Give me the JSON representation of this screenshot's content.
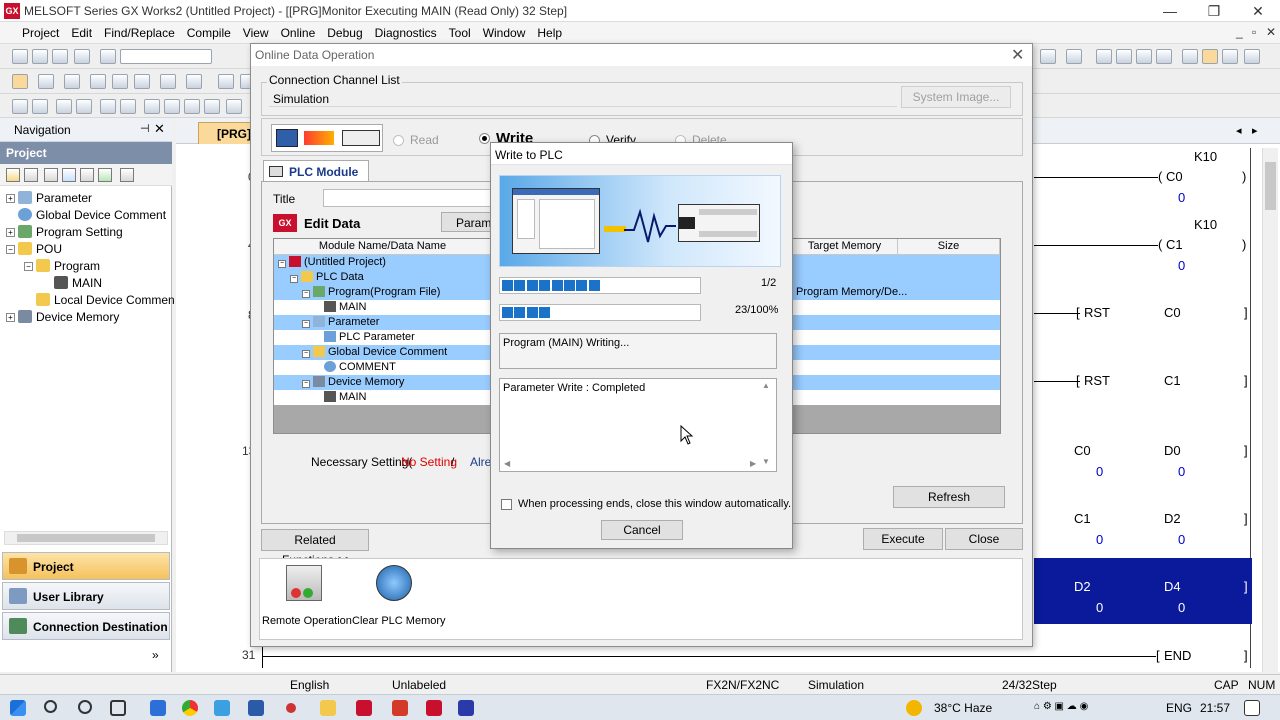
{
  "window": {
    "title": "MELSOFT Series GX Works2 (Untitled Project) - [[PRG]Monitor Executing MAIN (Read Only) 32 Step]",
    "app_icon": "GX",
    "controls": [
      "—",
      "❐",
      "✕"
    ]
  },
  "menubar": {
    "items": [
      "Project",
      "Edit",
      "Find/Replace",
      "Compile",
      "View",
      "Online",
      "Debug",
      "Diagnostics",
      "Tool",
      "Window",
      "Help"
    ],
    "mdi_controls": [
      "_",
      "▫",
      "✕"
    ]
  },
  "navigation": {
    "title": "Navigation",
    "pin": "⊣",
    "close": "✕",
    "section_title": "Project",
    "tree": [
      {
        "label": "Parameter",
        "level": 0,
        "expander": "+"
      },
      {
        "label": "Global Device Comment",
        "level": 0,
        "expander": ""
      },
      {
        "label": "Program Setting",
        "level": 0,
        "expander": "+"
      },
      {
        "label": "POU",
        "level": 0,
        "expander": "−"
      },
      {
        "label": "Program",
        "level": 1,
        "expander": "−"
      },
      {
        "label": "MAIN",
        "level": 2,
        "expander": ""
      },
      {
        "label": "Local Device Commen",
        "level": 1,
        "expander": ""
      },
      {
        "label": "Device Memory",
        "level": 0,
        "expander": "+"
      }
    ],
    "bottom_buttons": [
      "Project",
      "User Library",
      "Connection Destination"
    ],
    "more": "»"
  },
  "editor": {
    "tab_label": "[PRG]",
    "tab_nav": [
      "◂",
      "▸"
    ],
    "rung_numbers": [
      "0",
      "4",
      "8",
      "13",
      "31"
    ],
    "labels": {
      "k10_a": "K10",
      "c0_coil": "C0",
      "c0_val": "0",
      "k10_b": "K10",
      "c1_coil": "C1",
      "c1_val": "0",
      "rst1": "RST",
      "rst1_dev": "C0",
      "rst2": "RST",
      "rst2_dev": "C1",
      "cmp1_a": "C0",
      "cmp1_b": "D0",
      "cmp1_av": "0",
      "cmp1_bv": "0",
      "cmp2_a": "C1",
      "cmp2_b": "D2",
      "cmp2_av": "0",
      "cmp2_bv": "0",
      "cmp3_a": "D2",
      "cmp3_b": "D4",
      "cmp3_av": "0",
      "cmp3_bv": "0",
      "end": "END"
    }
  },
  "status_bar": {
    "language": "English",
    "label_mode": "Unlabeled",
    "cpu": "FX2N/FX2NC",
    "connection": "Simulation",
    "steps": "24/32Step",
    "caps": "CAP",
    "num": "NUM"
  },
  "taskbar": {
    "weather": "38°C Haze",
    "lang": "ENG",
    "time": "21:57"
  },
  "online_data_operation": {
    "title": "Online Data Operation",
    "close": "✕",
    "channel_label": "Connection Channel List",
    "channel_value": "Simulation",
    "system_image_btn": "System Image...",
    "modes": [
      {
        "label": "Read",
        "selected": false,
        "enabled": true
      },
      {
        "label": "Write",
        "selected": true,
        "enabled": true
      },
      {
        "label": "Verify",
        "selected": false,
        "enabled": true
      },
      {
        "label": "Delete",
        "selected": false,
        "enabled": false
      }
    ],
    "plc_module_tab": "PLC Module",
    "title_label": "Title",
    "edit_data": "Edit Data",
    "parameter_btn": "Paramet",
    "columns": [
      "Module Name/Data Name",
      "Target Memory Setting",
      "Size"
    ],
    "rows": [
      {
        "label": "(Untitled Project)",
        "indent": 0,
        "exp": "−",
        "target": "",
        "hl": true
      },
      {
        "label": "PLC Data",
        "indent": 1,
        "exp": "−",
        "target": "",
        "hl": true
      },
      {
        "label": "Program(Program File)",
        "indent": 2,
        "exp": "−",
        "target": "Program Memory/De...",
        "hl": true
      },
      {
        "label": "MAIN",
        "indent": 3,
        "exp": "",
        "target": "",
        "hl": false
      },
      {
        "label": "Parameter",
        "indent": 2,
        "exp": "−",
        "target": "",
        "hl": true
      },
      {
        "label": "PLC Parameter",
        "indent": 3,
        "exp": "",
        "target": "",
        "hl": false
      },
      {
        "label": "Global Device Comment",
        "indent": 2,
        "exp": "−",
        "target": "",
        "hl": true
      },
      {
        "label": "COMMENT",
        "indent": 3,
        "exp": "",
        "target": "",
        "hl": false
      },
      {
        "label": "Device Memory",
        "indent": 2,
        "exp": "−",
        "target": "",
        "hl": true
      },
      {
        "label": "MAIN",
        "indent": 3,
        "exp": "",
        "target": "",
        "hl": false
      }
    ],
    "necessary_setting": "Necessary Setting(",
    "no_setting": "No Setting",
    "slash": "/",
    "already": "Alrea",
    "refresh_btn": "Refresh",
    "related_functions_btn": "Related Functions<<",
    "execute_btn": "Execute",
    "close_btn": "Close",
    "related": [
      {
        "label": "Remote Operation",
        "icon": "remote-operation-icon"
      },
      {
        "label": "Clear PLC Memory",
        "icon": "clear-plc-memory-icon"
      }
    ]
  },
  "write_to_plc": {
    "title": "Write to PLC",
    "progress1": {
      "text": "1/2",
      "fraction": 0.5
    },
    "progress2": {
      "text": "23/100%",
      "fraction": 0.23
    },
    "status": "Program (MAIN) Writing...",
    "log": "Parameter Write : Completed",
    "auto_close_label": "When processing ends, close this window automatically.",
    "cancel_btn": "Cancel"
  },
  "colors": {
    "title_red": "#c8102e",
    "selection_blue": "#99ccff",
    "progress_blue": "#1a73c8",
    "ladder_highlight": "#0a1a9a",
    "monitor_value": "#0000c8",
    "no_setting_red": "#e00000"
  }
}
